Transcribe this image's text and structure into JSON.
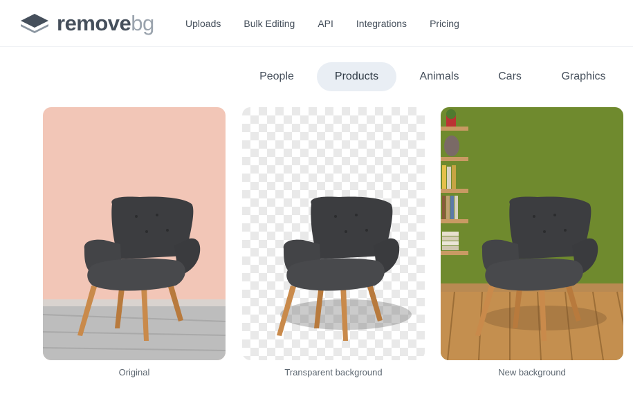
{
  "brand": {
    "name_bold": "remove",
    "name_light": "bg"
  },
  "nav": [
    "Uploads",
    "Bulk Editing",
    "API",
    "Integrations",
    "Pricing"
  ],
  "tabs": [
    {
      "label": "People",
      "active": false
    },
    {
      "label": "Products",
      "active": true
    },
    {
      "label": "Animals",
      "active": false
    },
    {
      "label": "Cars",
      "active": false
    },
    {
      "label": "Graphics",
      "active": false
    }
  ],
  "cards": [
    {
      "caption": "Original",
      "background": "pink-wall"
    },
    {
      "caption": "Transparent background",
      "background": "checkerboard"
    },
    {
      "caption": "New background",
      "background": "green-room"
    }
  ],
  "colors": {
    "text": "#454f5b",
    "tab_active_bg": "#e9eef4",
    "chair_fabric": "#3f4043",
    "chair_legs": "#c98a4b",
    "pink_wall": "#f3c7b9",
    "green_wall": "#6f8a2e",
    "floor_wood": "#c48f4f"
  }
}
